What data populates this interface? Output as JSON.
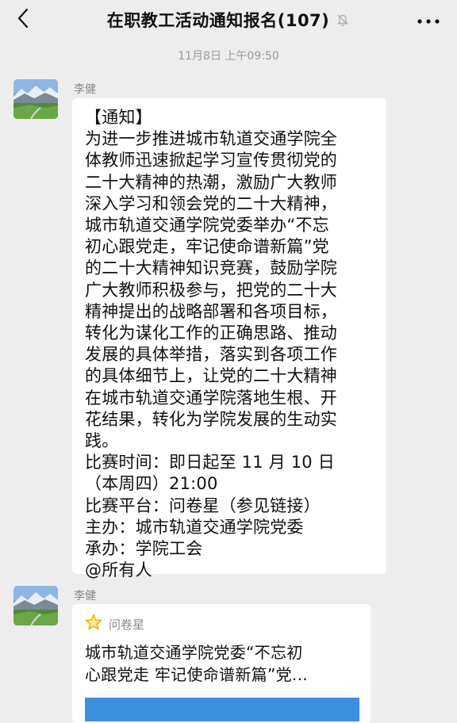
{
  "header": {
    "title": "在职教工活动通知报名(107)",
    "back_icon": "chevron-left-icon",
    "mute_icon": "bell-off-icon",
    "more_icon": "more-horizontal-icon"
  },
  "timestamp": "11月8日 上午09:50",
  "messages": [
    {
      "sender": "李健",
      "lines": [
        "【通知】",
        "为进一步推进城市轨道交通学院全",
        "体教师迅速掀起学习宣传贯彻党的",
        "二十大精神的热潮，激励广大教师",
        "深入学习和领会党的二十大精神，",
        "城市轨道交通学院党委举办“不忘",
        "初心跟党走，牢记使命谱新篇”党",
        "的二十大精神知识竞赛，鼓励学院",
        "广大教师积极参与，把党的二十大",
        "精神提出的战略部署和各项目标，",
        "转化为谋化工作的正确思路、推动",
        "发展的具体举措，落实到各项工作",
        "的具体细节上，让党的二十大精神",
        "在城市轨道交通学院落地生根、开",
        "花结果，转化为学院发展的生动实",
        "践。",
        "比赛时间：即日起至 11 月 10 日",
        "（本周四）21:00",
        "比赛平台：问卷星（参见链接）",
        "主办：城市轨道交通学院党委",
        "承办：学院工会",
        "@所有人"
      ]
    },
    {
      "sender": "李健",
      "card": {
        "source_icon": "star-icon",
        "source": "问卷星",
        "title_lines": [
          "城市轨道交通学院党委“不忘初",
          "心跟党走 牢记使命谱新篇”党..."
        ]
      }
    }
  ],
  "colors": {
    "background": "#ededed",
    "bubble": "#ffffff",
    "card_image": "#3d8fe0",
    "star": "#f5b400"
  }
}
